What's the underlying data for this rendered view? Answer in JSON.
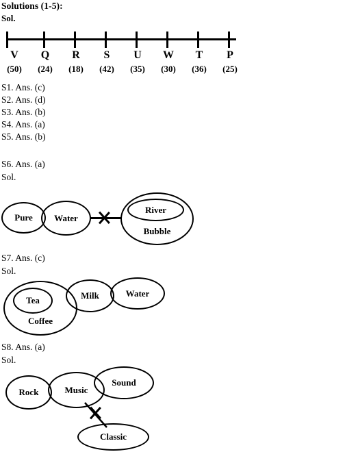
{
  "document": {
    "title": "Solutions (1-5):",
    "sol_label_bold": "Sol."
  },
  "number_line": {
    "points": [
      {
        "letter": "V",
        "value": "(50)"
      },
      {
        "letter": "Q",
        "value": "(24)"
      },
      {
        "letter": "R",
        "value": "(18)"
      },
      {
        "letter": "S",
        "value": "(42)"
      },
      {
        "letter": "U",
        "value": "(35)"
      },
      {
        "letter": "W",
        "value": "(30)"
      },
      {
        "letter": "T",
        "value": "(36)"
      },
      {
        "letter": "P",
        "value": "(25)"
      }
    ]
  },
  "answers": [
    {
      "id": "S1",
      "text": "S1. Ans. (c)"
    },
    {
      "id": "S2",
      "text": "S2. Ans. (d)"
    },
    {
      "id": "S3",
      "text": "S3. Ans. (b)"
    },
    {
      "id": "S4",
      "text": "S4. Ans. (a)"
    },
    {
      "id": "S5",
      "text": "S5. Ans. (b)"
    }
  ],
  "solutions": [
    {
      "id": "S6",
      "answer_text": "S6. Ans. (a)",
      "sol_text": "Sol.",
      "sets": [
        "Pure",
        "Water",
        "River",
        "Bubble"
      ]
    },
    {
      "id": "S7",
      "answer_text": "S7. Ans. (c)",
      "sol_text": "Sol.",
      "sets": [
        "Tea",
        "Coffee",
        "Milk",
        "Water"
      ]
    },
    {
      "id": "S8",
      "answer_text": "S8. Ans. (a)",
      "sol_text": "Sol.",
      "sets": [
        "Rock",
        "Music",
        "Sound",
        "Classic"
      ]
    }
  ],
  "colors": {
    "ink": "#000000",
    "paper": "#ffffff"
  }
}
